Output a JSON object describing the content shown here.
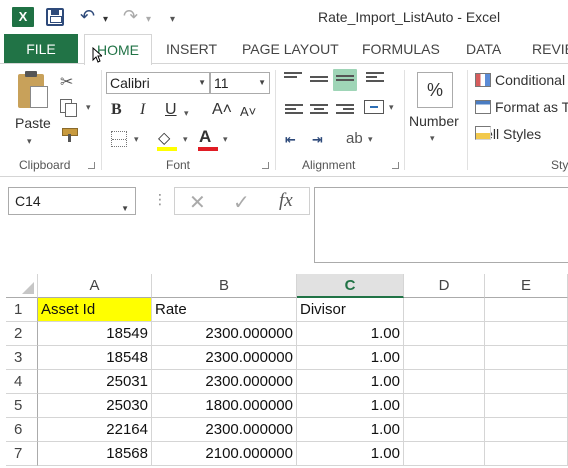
{
  "window": {
    "title": "Rate_Import_ListAuto - Excel",
    "app_logo": "X"
  },
  "quick_access": {
    "save_icon": "save-icon",
    "undo_glyph": "↶",
    "redo_glyph": "↷",
    "dropdown_glyph": "▾",
    "customize_glyph": "▾"
  },
  "tabs": {
    "file": "FILE",
    "home": "HOME",
    "insert": "INSERT",
    "page_layout": "PAGE LAYOUT",
    "formulas": "FORMULAS",
    "data": "DATA",
    "review": "REVIE"
  },
  "ribbon": {
    "clipboard": {
      "label": "Clipboard",
      "paste_label": "Paste",
      "cut_glyph": "✂"
    },
    "font": {
      "label": "Font",
      "font_name": "Calibri",
      "font_size": "11",
      "bold": "B",
      "italic": "I",
      "underline": "U",
      "grow": "A˄",
      "shrink": "A˅",
      "fill_glyph": "◇",
      "font_color_glyph": "A",
      "fill_color": "#ffff00",
      "font_color": "#e01c24"
    },
    "alignment": {
      "label": "Alignment",
      "decrease_indent": "⇤",
      "increase_indent": "⇥",
      "orientation_glyph": "ab"
    },
    "number": {
      "label": "Number",
      "percent_glyph": "%"
    },
    "styles": {
      "label": "Sty",
      "conditional": "Conditional",
      "format_as": "Format as T",
      "cell_styles": "Cell Styles"
    }
  },
  "formula_bar": {
    "name_box": "C14",
    "dots": "⋮",
    "cancel_glyph": "✕",
    "enter_glyph": "✓",
    "fx_glyph": "fx",
    "value": ""
  },
  "sheet": {
    "columns": [
      "A",
      "B",
      "C",
      "D",
      "E"
    ],
    "selected_column": "C",
    "row_numbers": [
      "1",
      "2",
      "3",
      "4",
      "5",
      "6",
      "7"
    ],
    "rows": [
      [
        "Asset Id",
        "Rate",
        "Divisor",
        "",
        ""
      ],
      [
        "18549",
        "2300.000000",
        "1.00",
        "",
        ""
      ],
      [
        "18548",
        "2300.000000",
        "1.00",
        "",
        ""
      ],
      [
        "25031",
        "2300.000000",
        "1.00",
        "",
        ""
      ],
      [
        "25030",
        "1800.000000",
        "1.00",
        "",
        ""
      ],
      [
        "22164",
        "2300.000000",
        "1.00",
        "",
        ""
      ],
      [
        "18568",
        "2100.000000",
        "1.00",
        "",
        ""
      ]
    ],
    "highlight_color": "#ffff00"
  }
}
